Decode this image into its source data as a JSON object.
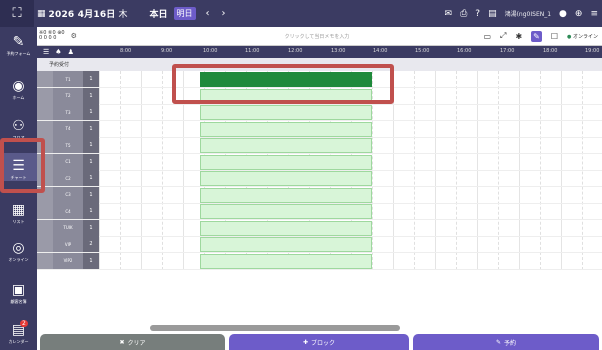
{
  "topbar": {
    "date": "2026 4月16日",
    "dow": "木",
    "today": "本日",
    "tomorrow": "明日",
    "prev": "‹",
    "next": "›",
    "user": "鴻湯(ng0ISEN_1"
  },
  "toolbar": {
    "counts_line1": "※0 ⑥0 ⊕0",
    "counts_line2": "0 0 0 0",
    "search_placeholder": "クリックして当日メモを入力",
    "online": "オンライン"
  },
  "grid": {
    "sub_header": "予約受付",
    "times": [
      "8:00",
      "9:00",
      "10:00",
      "11:00",
      "12:00",
      "13:00",
      "14:00",
      "15:00",
      "16:00",
      "17:00",
      "18:00",
      "19:00"
    ],
    "rows": [
      {
        "name": "T1",
        "cap": "1"
      },
      {
        "name": "T2",
        "cap": "1"
      },
      {
        "name": "T3",
        "cap": "1"
      },
      {
        "name": "T4",
        "cap": "1"
      },
      {
        "name": "T5",
        "cap": "1"
      },
      {
        "name": "C1",
        "cap": "1"
      },
      {
        "name": "C2",
        "cap": "1"
      },
      {
        "name": "C3",
        "cap": "1"
      },
      {
        "name": "C4",
        "cap": "1"
      },
      {
        "name": "TUIK",
        "cap": "1"
      },
      {
        "name": "VIP",
        "cap": "2"
      },
      {
        "name": "VIP2",
        "cap": "1"
      }
    ]
  },
  "sidebar": {
    "items": [
      {
        "icon": "✎",
        "label": "予約フォーム"
      },
      {
        "icon": "◉",
        "label": "ホーム"
      },
      {
        "icon": "⚇",
        "label": "フロア"
      },
      {
        "icon": "☰",
        "label": "チャート"
      },
      {
        "icon": "▦",
        "label": "リスト"
      },
      {
        "icon": "◎",
        "label": "オンライン"
      },
      {
        "icon": "▣",
        "label": "顧客名簿"
      },
      {
        "icon": "▤",
        "label": "カレンダー"
      }
    ],
    "badge": "2"
  },
  "bottom": {
    "clear": "クリア",
    "block": "ブロック",
    "reserve": "予約"
  },
  "colors": {
    "primary": "#3b3b62",
    "accent": "#6d5cc9",
    "green": "#1f8a3b",
    "highlight": "#c0504d"
  }
}
